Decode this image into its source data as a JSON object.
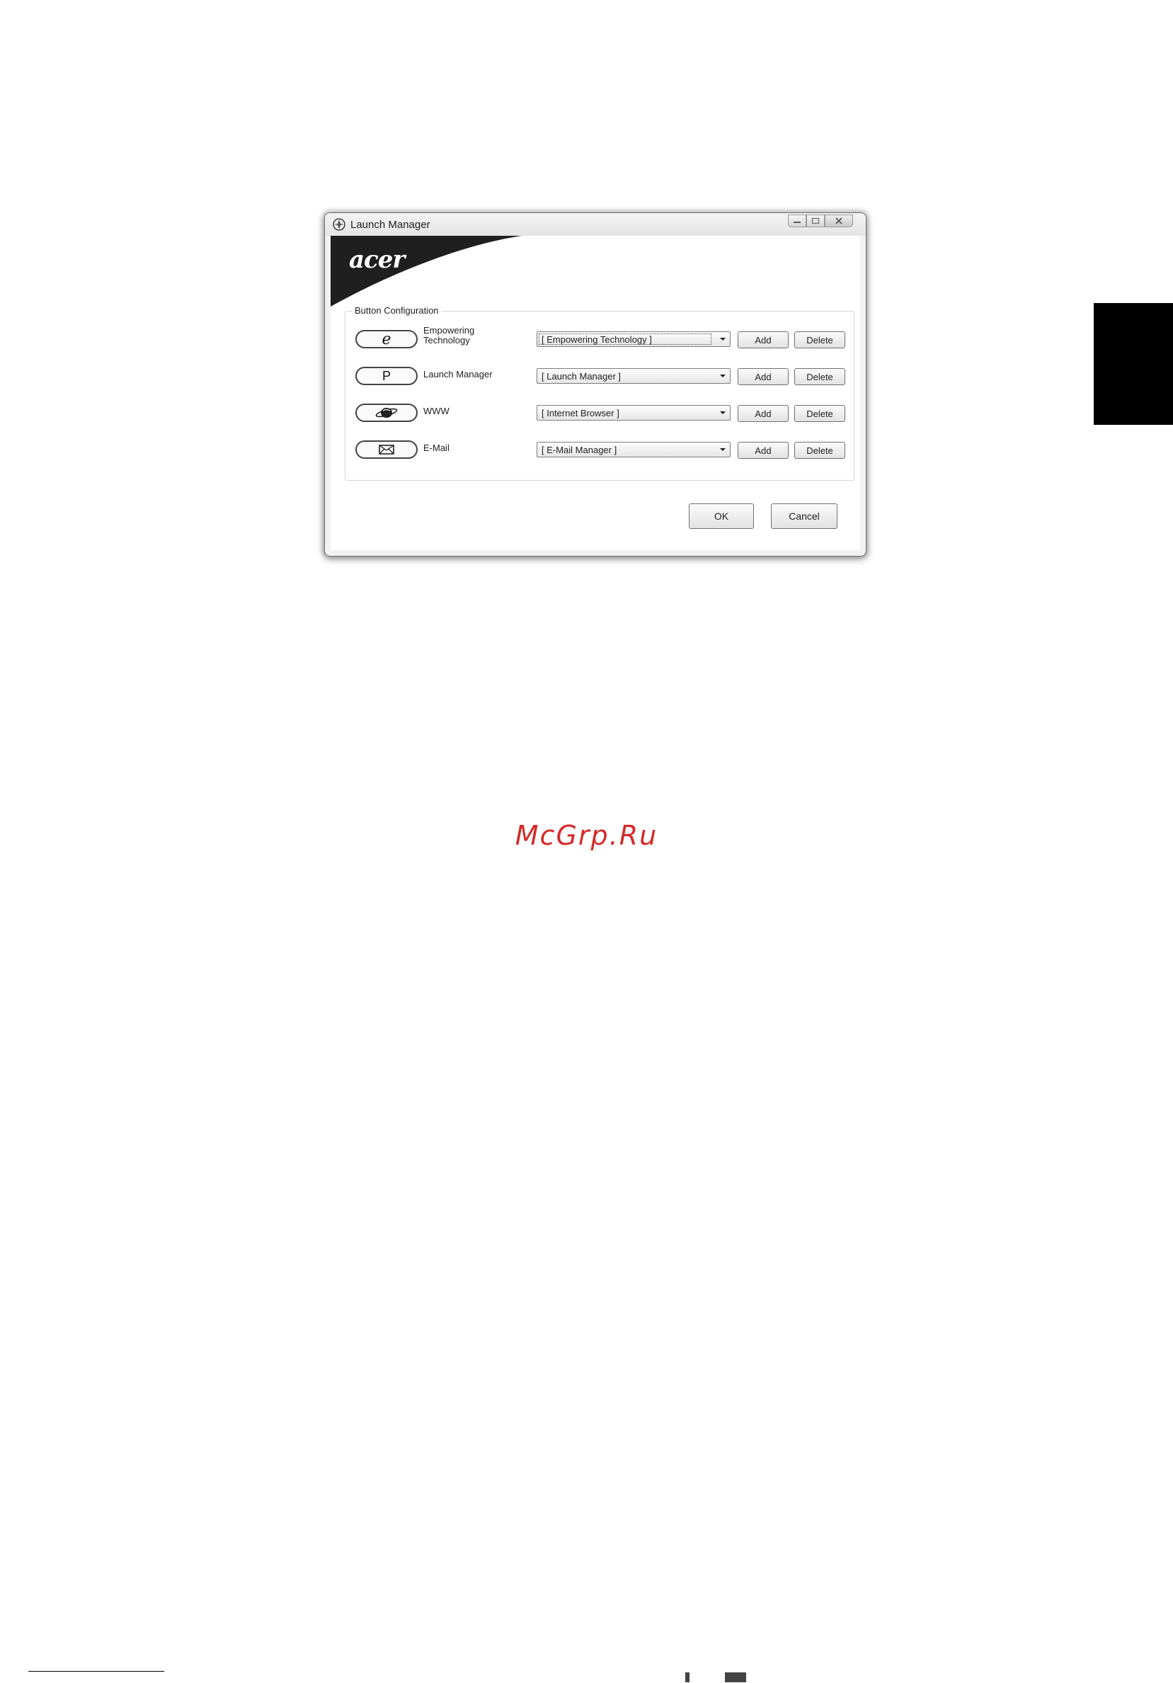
{
  "window": {
    "title": "Launch Manager",
    "logo": "acer",
    "group_title": "Button Configuration",
    "rows": [
      {
        "button_symbol": "e",
        "label_line1": "Empowering",
        "label_line2": "Technology",
        "combo_value": "[ Empowering Technology ]",
        "add_label": "Add",
        "delete_label": "Delete"
      },
      {
        "button_symbol": "P",
        "label_line1": "Launch Manager",
        "label_line2": "",
        "combo_value": "[ Launch Manager ]",
        "add_label": "Add",
        "delete_label": "Delete"
      },
      {
        "button_symbol": "",
        "label_line1": "WWW",
        "label_line2": "",
        "combo_value": "[ Internet Browser ]",
        "add_label": "Add",
        "delete_label": "Delete"
      },
      {
        "button_symbol": "",
        "label_line1": "E-Mail",
        "label_line2": "",
        "combo_value": "[ E-Mail Manager ]",
        "add_label": "Add",
        "delete_label": "Delete"
      }
    ],
    "ok_label": "OK",
    "cancel_label": "Cancel"
  },
  "watermark": "McGrp.Ru",
  "colors": {
    "watermark": "#d42a2a",
    "banner": "#1f1f1f",
    "side_tab": "#000000"
  }
}
